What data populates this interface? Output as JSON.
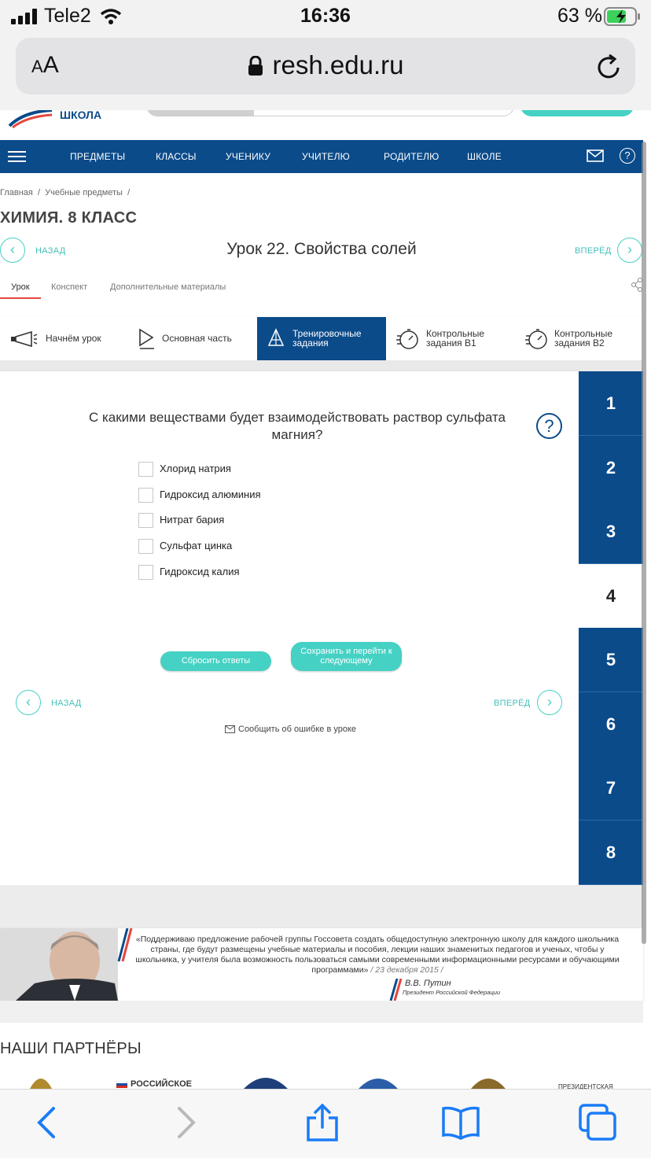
{
  "status_bar": {
    "carrier": "Tele2",
    "time": "16:36",
    "battery": "63 %"
  },
  "browser": {
    "text_size_label": "AA",
    "url": "resh.edu.ru"
  },
  "site": {
    "logo_text": "ШКОЛА",
    "nav": [
      "ПРЕДМЕТЫ",
      "КЛАССЫ",
      "УЧЕНИКУ",
      "УЧИТЕЛЮ",
      "РОДИТЕЛЮ",
      "ШКОЛЕ"
    ]
  },
  "breadcrumb": [
    "Главная",
    "Учебные предметы"
  ],
  "course_title": "ХИМИЯ. 8 КЛАСС",
  "lesson": {
    "back": "НАЗАД",
    "forward": "ВПЕРЁД",
    "title": "Урок 22. Свойства солей"
  },
  "tabs": [
    "Урок",
    "Конспект",
    "Дополнительные материалы"
  ],
  "stages": [
    {
      "line1": "Начнём урок",
      "line2": ""
    },
    {
      "line1": "Основная часть",
      "line2": ""
    },
    {
      "line1": "Тренировочные",
      "line2": "задания",
      "active": true
    },
    {
      "line1": "Контрольные",
      "line2": "задания В1"
    },
    {
      "line1": "Контрольные",
      "line2": "задания В2"
    }
  ],
  "task": {
    "question": "С какими веществами будет взаимодействовать раствор сульфата магния?",
    "help": "?",
    "options": [
      "Хлорид натрия",
      "Гидроксид алюминия",
      "Нитрат бария",
      "Сульфат цинка",
      "Гидроксид калия"
    ],
    "reset_label": "Сбросить ответы",
    "save_label": "Сохранить и перейти к следующему",
    "back": "НАЗАД",
    "forward": "ВПЕРЁД",
    "report": "Сообщить об ошибке в уроке"
  },
  "task_numbers": [
    "1",
    "2",
    "3",
    "4",
    "5",
    "6",
    "7",
    "8"
  ],
  "active_task": "4",
  "banner": {
    "quote": "«Поддерживаю предложение рабочей группы Госсовета создать общедоступную электронную школу для каждого школьника страны, где будут размещены учебные материалы и пособия, лекции наших знаменитых педагогов и ученых, чтобы у школьника, у учителя была возможность пользоваться самыми современными информационными ресурсами и обучающими программами»",
    "date": "/ 23 декабря 2015 /",
    "signer": "В.В. Путин",
    "signer_role": "Президент Российской Федерации"
  },
  "partners": {
    "title": "НАШИ ПАРТНЁРЫ",
    "logo1": "РОССИЙСКОЕ",
    "logo2": "ПРЕЗИДЕНТСКАЯ"
  },
  "colors": {
    "nav_blue": "#0b4b8a",
    "teal": "#45d1c4",
    "ios_blue": "#1a7cf6"
  }
}
